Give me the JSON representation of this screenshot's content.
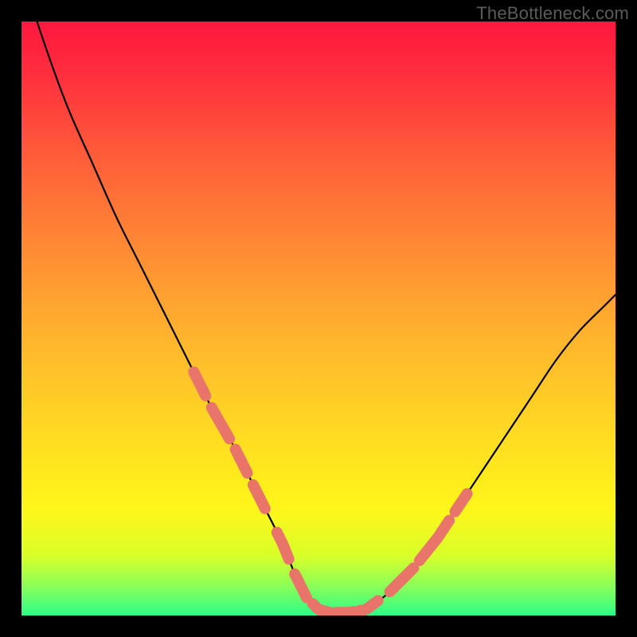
{
  "watermark": "TheBottleneck.com",
  "accent_color": "#e9746a",
  "chart_data": {
    "type": "line",
    "title": "",
    "xlabel": "",
    "ylabel": "",
    "xlim": [
      0,
      100
    ],
    "ylim": [
      0,
      100
    ],
    "series": [
      {
        "name": "bottleneck-curve",
        "x": [
          0,
          2,
          5,
          8,
          12,
          16,
          20,
          24,
          28,
          32,
          36,
          40,
          44,
          46,
          48,
          50,
          52,
          55,
          58,
          62,
          66,
          70,
          74,
          78,
          82,
          86,
          90,
          94,
          98,
          100
        ],
        "y": [
          110,
          102,
          93,
          85,
          76,
          67,
          59,
          51,
          43,
          35,
          28,
          20,
          12,
          7,
          3,
          1,
          0.5,
          0.5,
          1,
          4,
          8,
          13,
          19,
          25,
          31,
          37,
          43,
          48,
          52,
          54
        ]
      }
    ],
    "highlight_segments": [
      {
        "x0": 29,
        "x1": 31
      },
      {
        "x0": 32,
        "x1": 35
      },
      {
        "x0": 36,
        "x1": 38
      },
      {
        "x0": 39,
        "x1": 41
      },
      {
        "x0": 43,
        "x1": 45
      },
      {
        "x0": 46,
        "x1": 48
      },
      {
        "x0": 49,
        "x1": 52
      },
      {
        "x0": 53,
        "x1": 56
      },
      {
        "x0": 57,
        "x1": 60
      },
      {
        "x0": 62,
        "x1": 66
      },
      {
        "x0": 67,
        "x1": 72
      },
      {
        "x0": 73,
        "x1": 75
      }
    ]
  }
}
